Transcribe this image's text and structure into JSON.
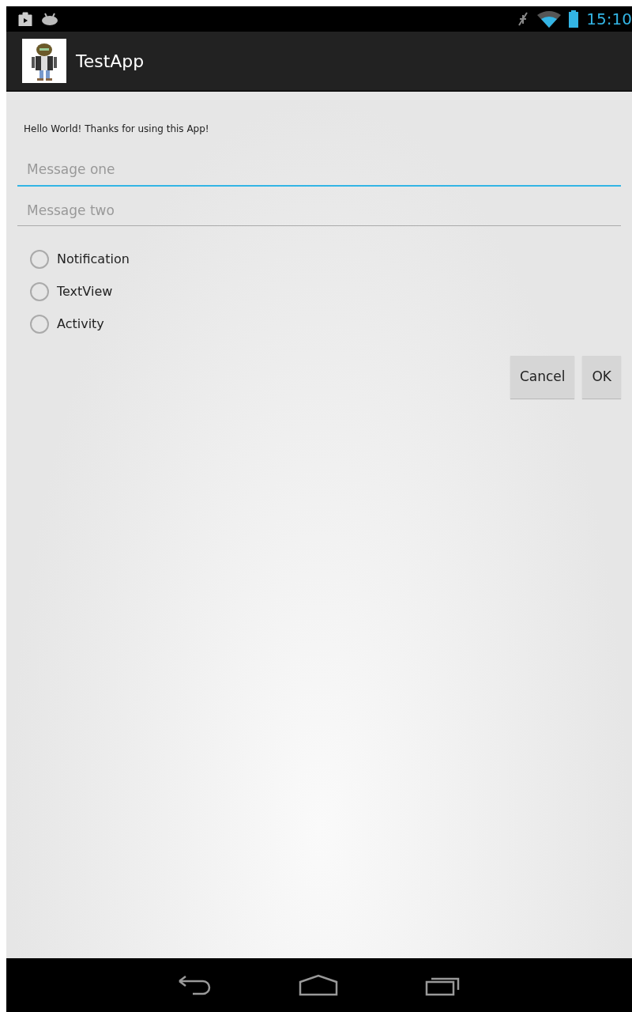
{
  "status_bar": {
    "time": "15:10"
  },
  "action_bar": {
    "title": "TestApp"
  },
  "greeting": "Hello World! Thanks for using this App!",
  "fields": [
    {
      "placeholder": "Message one",
      "focused": true
    },
    {
      "placeholder": "Message two",
      "focused": false
    }
  ],
  "options": [
    {
      "label": "Notification",
      "selected": false
    },
    {
      "label": "TextView",
      "selected": false
    },
    {
      "label": "Activity",
      "selected": false
    }
  ],
  "buttons": [
    "Cancel",
    "OK"
  ]
}
